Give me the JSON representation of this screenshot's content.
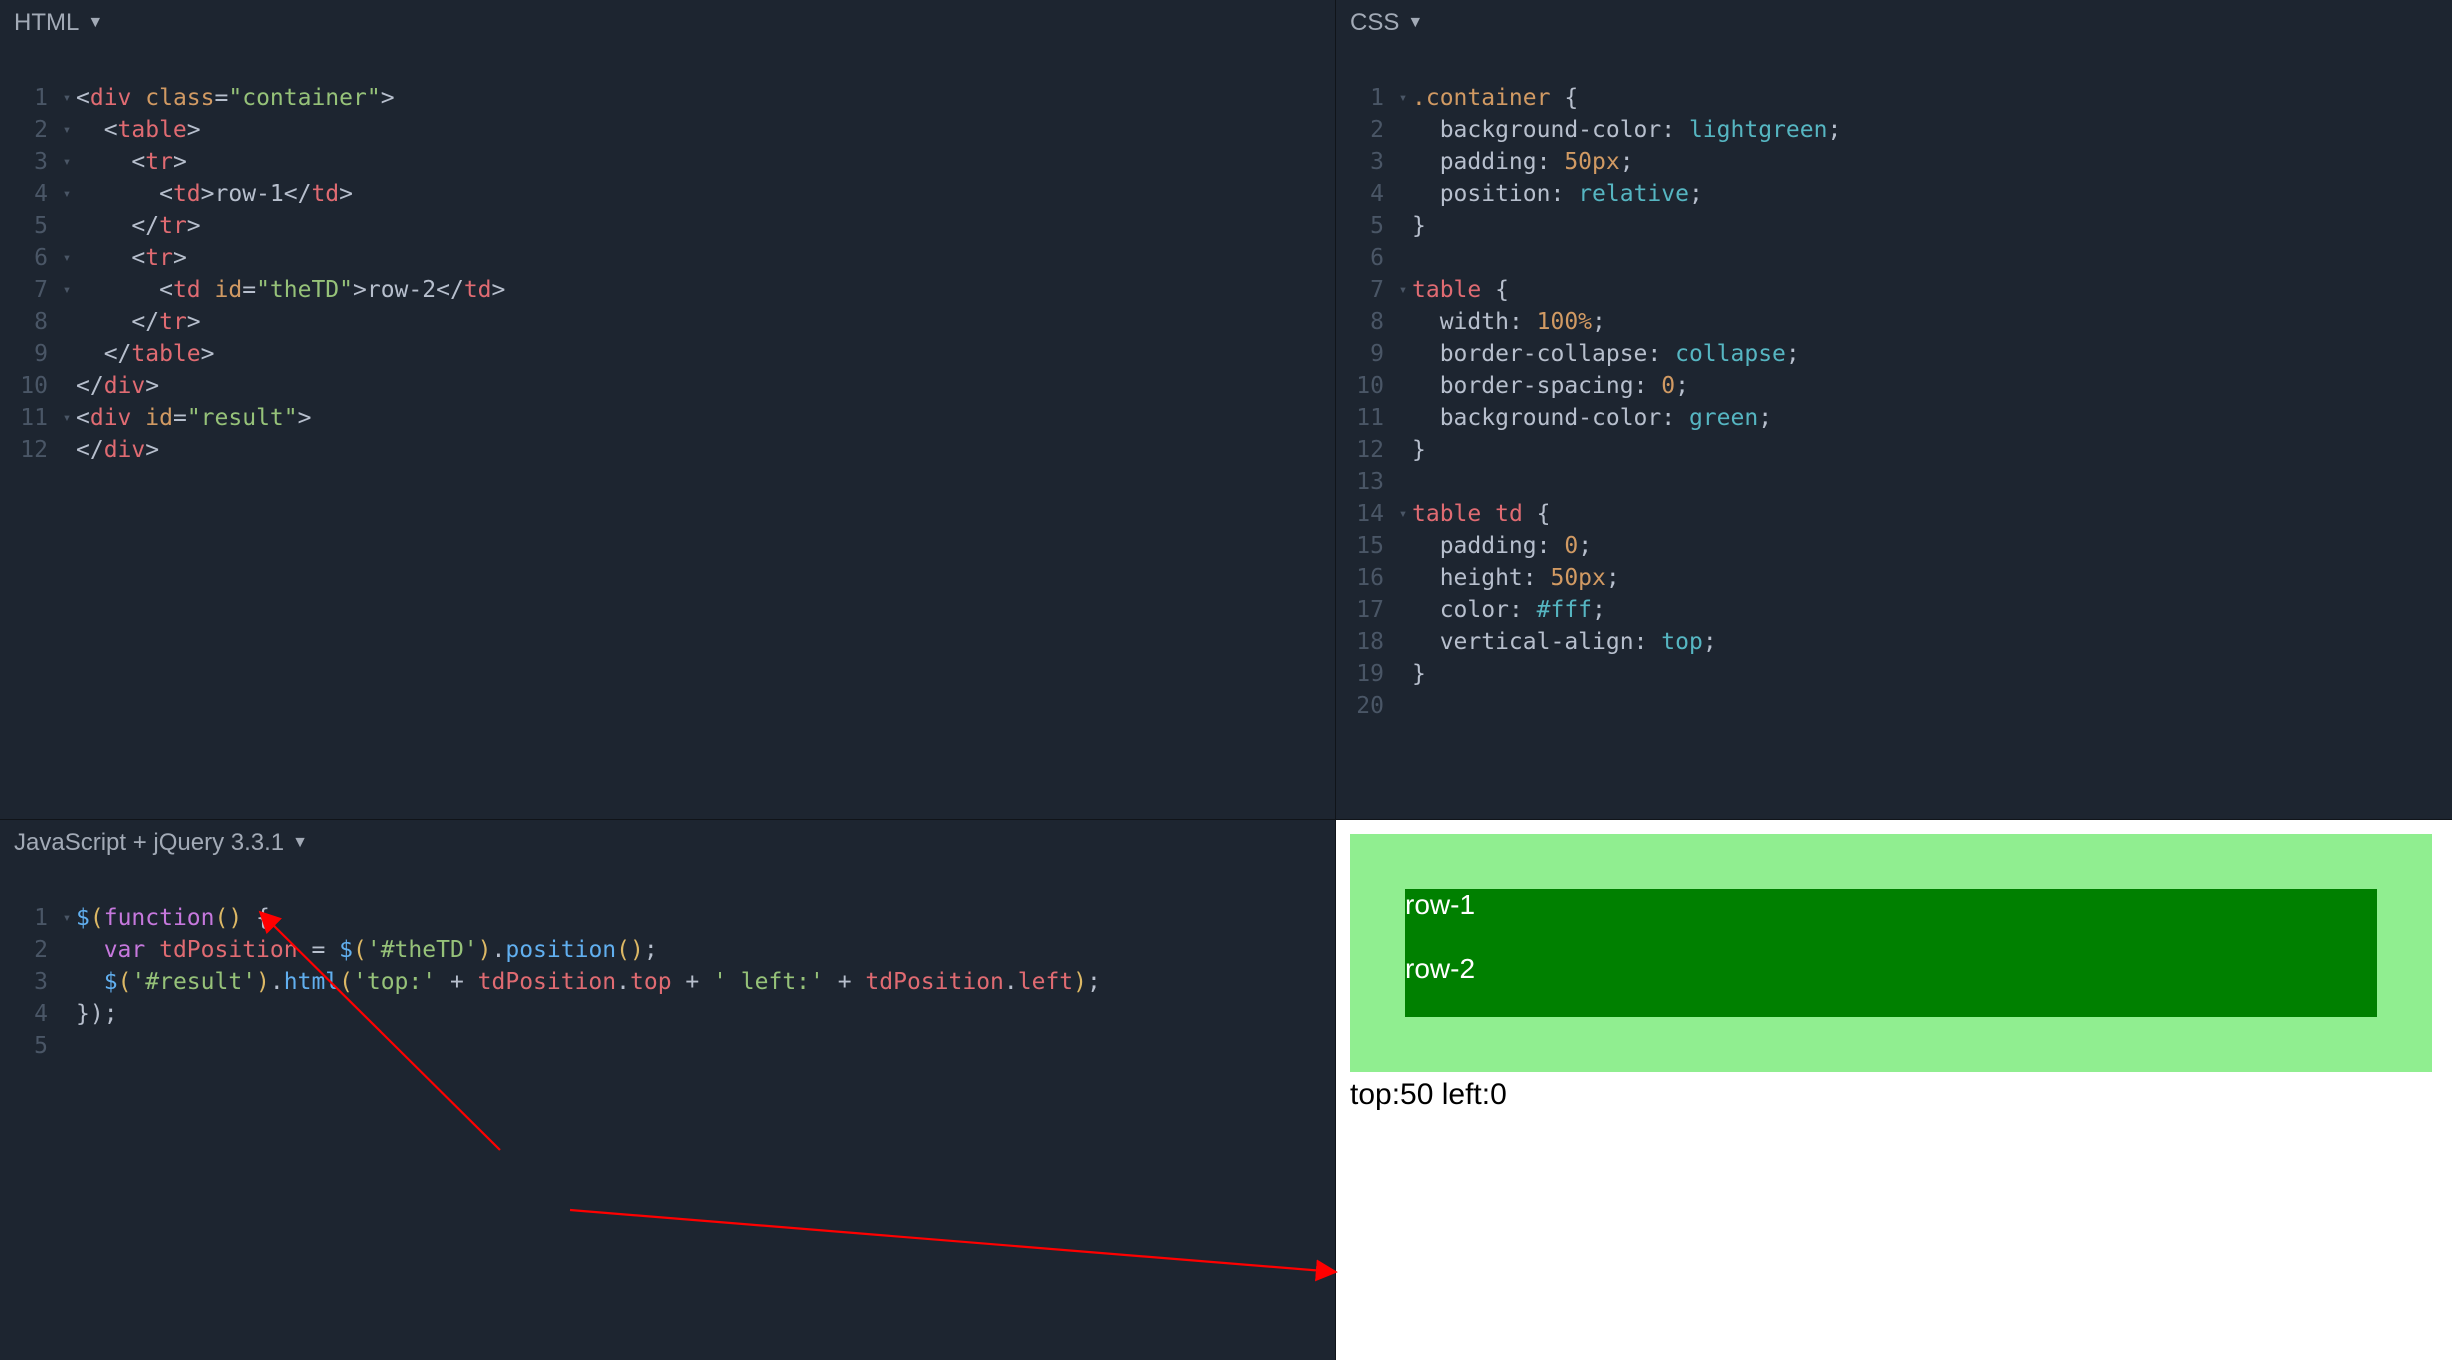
{
  "panes": {
    "html": {
      "title": "HTML"
    },
    "css": {
      "title": "CSS"
    },
    "js": {
      "title": "JavaScript + jQuery 3.3.1"
    }
  },
  "gutters": {
    "html": [
      "1",
      "2",
      "3",
      "4",
      "5",
      "6",
      "7",
      "8",
      "9",
      "10",
      "11",
      "12"
    ],
    "css": [
      "1",
      "2",
      "3",
      "4",
      "5",
      "6",
      "7",
      "8",
      "9",
      "10",
      "11",
      "12",
      "13",
      "14",
      "15",
      "16",
      "17",
      "18",
      "19",
      "20"
    ],
    "js": [
      "1",
      "2",
      "3",
      "4",
      "5"
    ]
  },
  "folds": {
    "html": [
      "▾",
      "▾",
      "▾",
      "▾",
      "",
      "▾",
      "▾",
      "",
      "",
      "",
      "▾",
      ""
    ],
    "css": [
      "▾",
      "",
      "",
      "",
      "",
      "",
      "▾",
      "",
      "",
      "",
      "",
      "",
      "",
      "▾",
      "",
      "",
      "",
      "",
      "",
      ""
    ],
    "js": [
      "▾",
      "",
      "",
      "",
      ""
    ]
  },
  "code": {
    "html": {
      "l1": {
        "s": [
          [
            "<",
            "c-punct"
          ],
          [
            "div",
            "c-tag"
          ],
          [
            " ",
            "c-punct"
          ],
          [
            "class",
            "c-attr"
          ],
          [
            "=",
            "c-punct"
          ],
          [
            "\"container\"",
            "c-str"
          ],
          [
            ">",
            "c-punct"
          ]
        ]
      },
      "l2": {
        "s": [
          [
            "  <",
            "c-punct"
          ],
          [
            "table",
            "c-tag"
          ],
          [
            ">",
            "c-punct"
          ]
        ]
      },
      "l3": {
        "s": [
          [
            "    <",
            "c-punct"
          ],
          [
            "tr",
            "c-tag"
          ],
          [
            ">",
            "c-punct"
          ]
        ]
      },
      "l4": {
        "s": [
          [
            "      <",
            "c-punct"
          ],
          [
            "td",
            "c-tag"
          ],
          [
            ">",
            "c-punct"
          ],
          [
            "row-1",
            "c-text"
          ],
          [
            "</",
            "c-punct"
          ],
          [
            "td",
            "c-tag"
          ],
          [
            ">",
            "c-punct"
          ]
        ]
      },
      "l5": {
        "s": [
          [
            "    </",
            "c-punct"
          ],
          [
            "tr",
            "c-tag"
          ],
          [
            ">",
            "c-punct"
          ]
        ]
      },
      "l6": {
        "s": [
          [
            "    <",
            "c-punct"
          ],
          [
            "tr",
            "c-tag"
          ],
          [
            ">",
            "c-punct"
          ]
        ]
      },
      "l7": {
        "s": [
          [
            "      <",
            "c-punct"
          ],
          [
            "td",
            "c-tag"
          ],
          [
            " ",
            "c-punct"
          ],
          [
            "id",
            "c-attr"
          ],
          [
            "=",
            "c-punct"
          ],
          [
            "\"theTD\"",
            "c-str"
          ],
          [
            ">",
            "c-punct"
          ],
          [
            "row-2",
            "c-text"
          ],
          [
            "</",
            "c-punct"
          ],
          [
            "td",
            "c-tag"
          ],
          [
            ">",
            "c-punct"
          ]
        ]
      },
      "l8": {
        "s": [
          [
            "    </",
            "c-punct"
          ],
          [
            "tr",
            "c-tag"
          ],
          [
            ">",
            "c-punct"
          ]
        ]
      },
      "l9": {
        "s": [
          [
            "  </",
            "c-punct"
          ],
          [
            "table",
            "c-tag"
          ],
          [
            ">",
            "c-punct"
          ]
        ]
      },
      "l10": {
        "s": [
          [
            "</",
            "c-punct"
          ],
          [
            "div",
            "c-tag"
          ],
          [
            ">",
            "c-punct"
          ]
        ]
      },
      "l11": {
        "s": [
          [
            "<",
            "c-punct"
          ],
          [
            "div",
            "c-tag"
          ],
          [
            " ",
            "c-punct"
          ],
          [
            "id",
            "c-attr"
          ],
          [
            "=",
            "c-punct"
          ],
          [
            "\"result\"",
            "c-str"
          ],
          [
            ">",
            "c-punct"
          ]
        ]
      },
      "l12": {
        "s": [
          [
            "</",
            "c-punct"
          ],
          [
            "div",
            "c-tag"
          ],
          [
            ">",
            "c-punct"
          ]
        ]
      }
    },
    "css": {
      "l1": {
        "s": [
          [
            ".container",
            "c-sel"
          ],
          [
            " {",
            "c-text"
          ]
        ]
      },
      "l2": {
        "s": [
          [
            "  background-color",
            "c-prop"
          ],
          [
            ": ",
            "c-text"
          ],
          [
            "lightgreen",
            "c-val"
          ],
          [
            ";",
            "c-text"
          ]
        ]
      },
      "l3": {
        "s": [
          [
            "  padding",
            "c-prop"
          ],
          [
            ": ",
            "c-text"
          ],
          [
            "50px",
            "c-num"
          ],
          [
            ";",
            "c-text"
          ]
        ]
      },
      "l4": {
        "s": [
          [
            "  position",
            "c-prop"
          ],
          [
            ": ",
            "c-text"
          ],
          [
            "relative",
            "c-val"
          ],
          [
            ";",
            "c-text"
          ]
        ]
      },
      "l5": {
        "s": [
          [
            "}",
            "c-text"
          ]
        ]
      },
      "l6": {
        "s": [
          [
            "",
            "c-text"
          ]
        ]
      },
      "l7": {
        "s": [
          [
            "table",
            "c-tag"
          ],
          [
            " {",
            "c-text"
          ]
        ]
      },
      "l8": {
        "s": [
          [
            "  width",
            "c-prop"
          ],
          [
            ": ",
            "c-text"
          ],
          [
            "100%",
            "c-num"
          ],
          [
            ";",
            "c-text"
          ]
        ]
      },
      "l9": {
        "s": [
          [
            "  border-collapse",
            "c-prop"
          ],
          [
            ": ",
            "c-text"
          ],
          [
            "collapse",
            "c-val"
          ],
          [
            ";",
            "c-text"
          ]
        ]
      },
      "l10": {
        "s": [
          [
            "  border-spacing",
            "c-prop"
          ],
          [
            ": ",
            "c-text"
          ],
          [
            "0",
            "c-num"
          ],
          [
            ";",
            "c-text"
          ]
        ]
      },
      "l11": {
        "s": [
          [
            "  background-color",
            "c-prop"
          ],
          [
            ": ",
            "c-text"
          ],
          [
            "green",
            "c-val"
          ],
          [
            ";",
            "c-text"
          ]
        ]
      },
      "l12": {
        "s": [
          [
            "}",
            "c-text"
          ]
        ]
      },
      "l13": {
        "s": [
          [
            "",
            "c-text"
          ]
        ]
      },
      "l14": {
        "s": [
          [
            "table",
            "c-tag"
          ],
          [
            " ",
            "c-text"
          ],
          [
            "td",
            "c-tag"
          ],
          [
            " {",
            "c-text"
          ]
        ]
      },
      "l15": {
        "s": [
          [
            "  padding",
            "c-prop"
          ],
          [
            ": ",
            "c-text"
          ],
          [
            "0",
            "c-num"
          ],
          [
            ";",
            "c-text"
          ]
        ]
      },
      "l16": {
        "s": [
          [
            "  height",
            "c-prop"
          ],
          [
            ": ",
            "c-text"
          ],
          [
            "50px",
            "c-num"
          ],
          [
            ";",
            "c-text"
          ]
        ]
      },
      "l17": {
        "s": [
          [
            "  color",
            "c-prop"
          ],
          [
            ": ",
            "c-text"
          ],
          [
            "#fff",
            "c-val"
          ],
          [
            ";",
            "c-text"
          ]
        ]
      },
      "l18": {
        "s": [
          [
            "  vertical-align",
            "c-prop"
          ],
          [
            ": ",
            "c-text"
          ],
          [
            "top",
            "c-val"
          ],
          [
            ";",
            "c-text"
          ]
        ]
      },
      "l19": {
        "s": [
          [
            "}",
            "c-text"
          ]
        ]
      },
      "l20": {
        "s": [
          [
            "",
            "c-text"
          ]
        ]
      }
    },
    "js": {
      "l1": {
        "s": [
          [
            "$",
            "c-id"
          ],
          [
            "(",
            "c-bracket"
          ],
          [
            "function",
            "c-kw"
          ],
          [
            "()",
            "c-bracket"
          ],
          [
            " {",
            "c-text"
          ]
        ]
      },
      "l2": {
        "s": [
          [
            "  ",
            "c-text"
          ],
          [
            "var",
            "c-kw"
          ],
          [
            " ",
            "c-text"
          ],
          [
            "tdPosition",
            "c-var"
          ],
          [
            " = ",
            "c-text"
          ],
          [
            "$",
            "c-id"
          ],
          [
            "(",
            "c-bracket"
          ],
          [
            "'#theTD'",
            "c-str"
          ],
          [
            ")",
            "c-bracket"
          ],
          [
            ".",
            "c-text"
          ],
          [
            "position",
            "c-fn"
          ],
          [
            "()",
            "c-bracket"
          ],
          [
            ";",
            "c-text"
          ]
        ]
      },
      "l3": {
        "s": [
          [
            "  ",
            "c-text"
          ],
          [
            "$",
            "c-id"
          ],
          [
            "(",
            "c-bracket"
          ],
          [
            "'#result'",
            "c-str"
          ],
          [
            ")",
            "c-bracket"
          ],
          [
            ".",
            "c-text"
          ],
          [
            "html",
            "c-fn"
          ],
          [
            "(",
            "c-bracket"
          ],
          [
            "'top:'",
            "c-str"
          ],
          [
            " + ",
            "c-text"
          ],
          [
            "tdPosition",
            "c-var"
          ],
          [
            ".",
            "c-text"
          ],
          [
            "top",
            "c-var"
          ],
          [
            " + ",
            "c-text"
          ],
          [
            "' left:'",
            "c-str"
          ],
          [
            " + ",
            "c-text"
          ],
          [
            "tdPosition",
            "c-var"
          ],
          [
            ".",
            "c-text"
          ],
          [
            "left",
            "c-var"
          ],
          [
            ")",
            "c-bracket"
          ],
          [
            ";",
            "c-text"
          ]
        ]
      },
      "l4": {
        "s": [
          [
            "});",
            "c-text"
          ]
        ]
      },
      "l5": {
        "s": [
          [
            "",
            "c-text"
          ]
        ]
      }
    }
  },
  "preview": {
    "row1": "row-1",
    "row2": "row-2",
    "result": "top:50 left:0"
  }
}
